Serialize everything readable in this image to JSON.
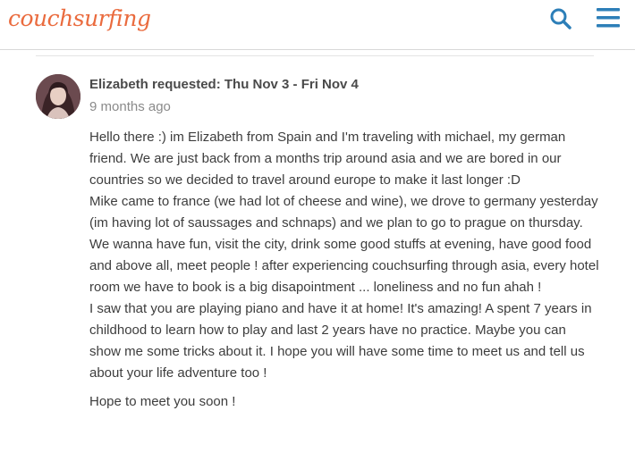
{
  "brand": {
    "logo_text": "couchsurfing",
    "accent": "#ea6b3e",
    "icon_color": "#2d7fb8"
  },
  "header": {
    "search_icon": "search-icon",
    "menu_icon": "hamburger-menu-icon"
  },
  "request": {
    "title": "Elizabeth requested: Thu Nov 3 - Fri Nov 4",
    "time_ago": "9 months ago",
    "message_lines": [
      "Hello there :) im Elizabeth from Spain and I'm traveling with michael, my german friend. We are just back from a months trip around asia and we are bored in our countries so we decided to travel around europe to make it last longer :D",
      "Mike came to france (we had lot of cheese and wine), we drove to germany yesterday (im having lot of saussages and schnaps) and we plan to go to prague on thursday.",
      "We wanna have fun, visit the city, drink some good stuffs at evening, have good food and above all, meet people ! after experiencing couchsurfing through asia, every hotel room we have to book is a big disapointment ... loneliness and no fun ahah !",
      "I saw that you are playing piano and have it at home! It's amazing! A spent 7 years in childhood to learn how to play and last 2 years have no practice. Maybe you can show me some tricks about it. I hope you will have some time to meet us and tell us about your life adventure too !"
    ],
    "closing": "Hope to meet you soon !"
  }
}
